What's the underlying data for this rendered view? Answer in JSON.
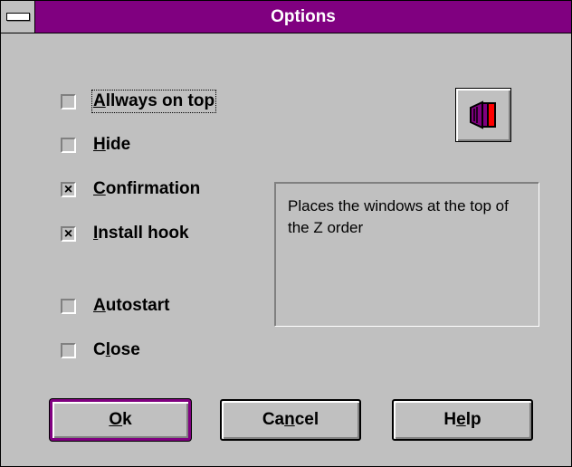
{
  "window": {
    "title": "Options"
  },
  "checkboxes": [
    {
      "label": "Allways on top",
      "mnemonic_index": 0,
      "checked": false,
      "focused": true
    },
    {
      "label": "Hide",
      "mnemonic_index": 0,
      "checked": false,
      "focused": false
    },
    {
      "label": "Confirmation",
      "mnemonic_index": 0,
      "checked": true,
      "focused": false
    },
    {
      "label": "Install hook",
      "mnemonic_index": 0,
      "checked": true,
      "focused": false
    },
    {
      "label": "Autostart",
      "mnemonic_index": 0,
      "checked": false,
      "focused": false
    },
    {
      "label": "Close",
      "mnemonic_index": 1,
      "checked": false,
      "focused": false
    }
  ],
  "check_mark": "×",
  "description": {
    "text": "Places the windows at the top of the Z order"
  },
  "icon_button": {
    "icon": "window-on-top-icon"
  },
  "buttons": {
    "ok": {
      "label": "Ok",
      "mnemonic_index": 0
    },
    "cancel": {
      "label": "Cancel",
      "mnemonic_index": 2
    },
    "help": {
      "label": "Help",
      "mnemonic_index": 1
    }
  },
  "colors": {
    "titlebar": "#800080",
    "face": "#c0c0c0",
    "icon_fill": "#800080",
    "icon_accent": "#ff0000"
  }
}
